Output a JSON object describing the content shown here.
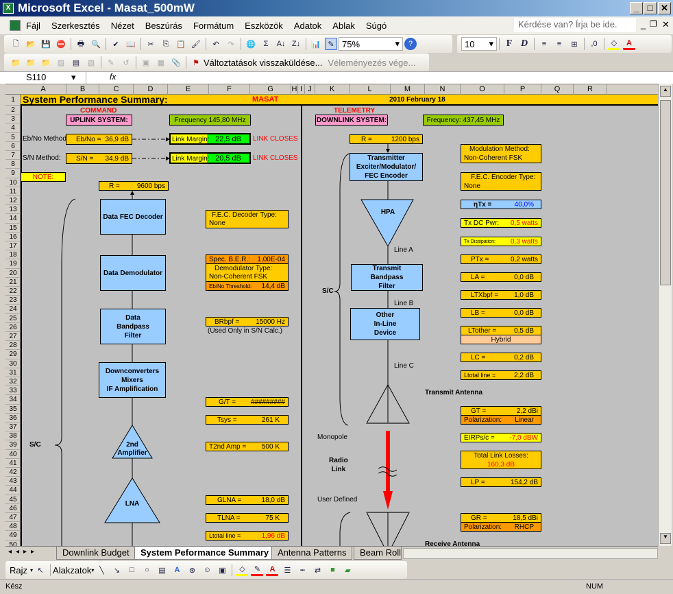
{
  "window": {
    "title": "Microsoft Excel - Masat_500mW"
  },
  "menu": {
    "items": [
      "Fájl",
      "Szerkesztés",
      "Nézet",
      "Beszúrás",
      "Formátum",
      "Eszközök",
      "Adatok",
      "Ablak",
      "Súgó"
    ],
    "help_placeholder": "Kérdése van? Írja be ide."
  },
  "toolbar": {
    "zoom": "75%",
    "font_size": "10",
    "bold": "F",
    "italic": "D",
    "review_send": "Változtatások visszaküldése...",
    "review_end": "Véleményezés vége..."
  },
  "formula_bar": {
    "name_box": "S110",
    "fx": "fx",
    "value": ""
  },
  "columns": [
    "A",
    "B",
    "C",
    "D",
    "E",
    "F",
    "G",
    "H",
    "I",
    "J",
    "K",
    "L",
    "M",
    "N",
    "O",
    "P",
    "Q",
    "R"
  ],
  "rows": [
    1,
    2,
    3,
    4,
    5,
    6,
    7,
    8,
    9,
    10,
    11,
    12,
    13,
    14,
    15,
    16,
    17,
    18,
    19,
    20,
    21,
    22,
    23,
    24,
    25,
    26,
    27,
    28,
    29,
    30,
    31,
    32,
    33,
    34,
    35,
    36,
    37,
    38,
    39,
    40,
    41,
    42,
    43,
    44,
    45,
    46,
    47,
    48,
    49,
    50
  ],
  "sheet": {
    "title": "System Performance Summary:",
    "satellite": "MASAT",
    "date": "2010 February 18",
    "uplink": {
      "section": "COMMAND",
      "system": "UPLINK SYSTEM:",
      "frequency": "Frequency  145,80 MHz",
      "ebno_method": "Eb/No Method",
      "ebno_label": "Eb/No =",
      "ebno_value": "36,9 dB",
      "sn_method": "S/N Method:",
      "sn_label": "S/N =",
      "sn_value": "34,9 dB",
      "margin_label": "Link Margin:",
      "margin1": "22,5 dB",
      "margin2": "20,5 dB",
      "closes": "LINK CLOSES",
      "note": "NOTE:",
      "rate_label": "R =",
      "rate_value": "9600 bps",
      "blocks": [
        "Data FEC Decoder",
        "Data Demodulator",
        "Data\nBandpass\nFilter",
        "Downconverters\nMixers\nIF Amplification"
      ],
      "amp2": "2nd\nAmplifier",
      "lna": "LNA",
      "sc": "S/C",
      "fec_type_label": "F.E.C. Decoder Type:",
      "fec_type": "None",
      "ber_label": "Spec. B.E.R.:",
      "ber": "1,00E-04",
      "demod_label": "Demodulator Type:",
      "demod": "Non-Coherent FSK",
      "thresh_label": "Eb/No Threshold:",
      "thresh": "14,4 dB",
      "br_label": "BRbpf =",
      "br": "15000 Hz",
      "br_note": "(Used Only in S/N Calc.)",
      "gt_label": "G/T =",
      "gt": "#########",
      "tsys_label": "Tsys =",
      "tsys": "261 K",
      "t2_label": "T2nd Amp =",
      "t2": "500 K",
      "glna_label": "GLNA =",
      "glna": "18,0 dB",
      "tlna_label": "TLNA =",
      "tlna": "75 K",
      "ltot_label": "Ltotal line =",
      "ltot": "1,96 dB"
    },
    "downlink": {
      "section": "TELEMETRY",
      "system": "DOWNLINK SYSTEM:",
      "frequency": "Frequency: 437,45 MHz",
      "rate_label": "R =",
      "rate_value": "1200 bps",
      "transmitter": "Transmitter\nExciter/Modulator/\nFEC Encoder",
      "hpa": "HPA",
      "bpf": "Transmit\nBandpass\nFilter",
      "other": "Other\nIn-Line\nDevice",
      "line_a": "Line A",
      "line_b": "Line B",
      "line_c": "Line C",
      "sc": "S/C",
      "tx_antenna": "Transmit Antenna",
      "monopole": "Monopole",
      "radio_link": "Radio\nLink",
      "user_defined": "User Defined",
      "rx_antenna": "Receive Antenna",
      "mod_label": "Modulation Method:",
      "mod": "Non-Coherent FSK",
      "fec_label": "F.E.C. Encoder Type:",
      "fec": "None",
      "eta_label": "ηTx =",
      "eta": "40,0%",
      "dcpwr_label": "Tx DC Pwr:",
      "dcpwr": "0,5 watts",
      "diss_label": "Tx Dissipation:",
      "diss": "0,3 watts",
      "ptx_label": "PTx =",
      "ptx": "0,2 watts",
      "la_label": "LA =",
      "la": "0,0 dB",
      "ltxbpf_label": "LTXbpf =",
      "ltxbpf": "1,0 dB",
      "lb_label": "LB =",
      "lb": "0,0 dB",
      "ltother_label": "LTother =",
      "ltother": "0,5 dB",
      "hybrid": "Hybrid",
      "lc_label": "LC =",
      "lc": "0,2 dB",
      "ltot_label": "Ltotal line =",
      "ltot": "2,2 dB",
      "gt_label": "GT =",
      "gt": "2,2 dBi",
      "pol_label": "Polarization:",
      "pol_tx": "Linear",
      "eirp_label": "EIRPs/c =",
      "eirp": "-7,0 dBW",
      "losses_label": "Total Link Losses:",
      "losses": "160,3 dB",
      "lp_label": "LP =",
      "lp": "154,2 dB",
      "gr_label": "GR =",
      "gr": "18,5 dBi",
      "pol_rx": "RHCP"
    }
  },
  "colors": {
    "title_bar": "#ffcc00",
    "block": "#99ccff",
    "value_box": "#ffcc00",
    "orange": "#ff9900",
    "pink": "#ff99cc",
    "green": "#99cc00",
    "margin_green": "#00ff00",
    "yellow": "#ffff00",
    "red": "#ff0000",
    "sheet_bg": "#c0c0c0"
  },
  "tabs": [
    "Downlink Budget",
    "System Peformance Summary",
    "Antenna Patterns",
    "Beam Roll"
  ],
  "active_tab": "System Peformance Summary",
  "drawing": {
    "draw": "Rajz",
    "shapes": "Alakzatok"
  },
  "status": {
    "ready": "Kész",
    "num": "NUM"
  }
}
